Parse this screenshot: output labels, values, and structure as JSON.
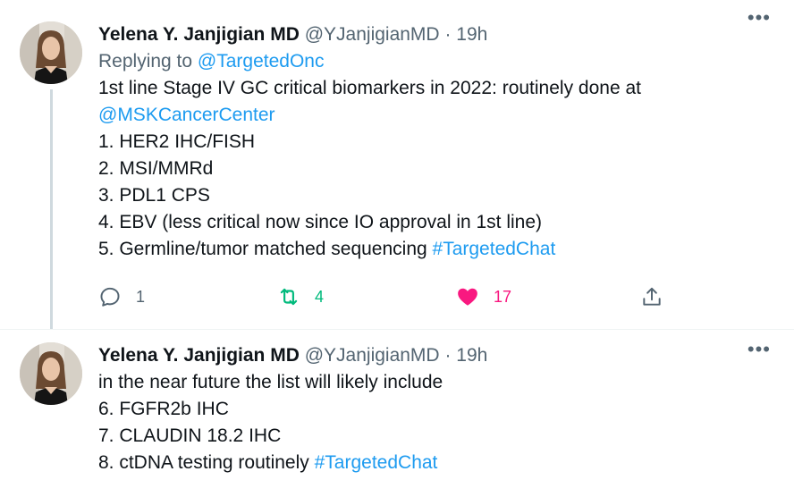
{
  "tweets": [
    {
      "author": {
        "name": "Yelena Y. Janjigian MD",
        "handle": "@YJanjigianMD"
      },
      "separator": "·",
      "time": "19h",
      "more_label": "•••",
      "reply_prefix": "Replying to ",
      "reply_handle": "@TargetedOnc",
      "lines": {
        "l1": "1st line Stage IV GC critical biomarkers in 2022: routinely done at",
        "l2_mention": "@MSKCancerCenter",
        "l3": "1. HER2 IHC/FISH",
        "l4": "2. MSI/MMRd",
        "l5": "3. PDL1 CPS",
        "l6": "4. EBV (less critical now since IO approval in 1st line)",
        "l7_text": "5. Germline/tumor matched sequencing ",
        "l7_hashtag": "#TargetedChat"
      },
      "actions": {
        "reply_count": "1",
        "retweet_count": "4",
        "like_count": "17",
        "liked": true,
        "retweeted": true
      },
      "icons": [
        "reply-icon",
        "retweet-icon",
        "heart-icon",
        "share-icon",
        "more-icon"
      ]
    },
    {
      "author": {
        "name": "Yelena Y. Janjigian MD",
        "handle": "@YJanjigianMD"
      },
      "separator": "·",
      "time": "19h",
      "more_label": "•••",
      "lines": {
        "l1": "in the near future the list will likely include",
        "l2": "6. FGFR2b IHC",
        "l3": "7. CLAUDIN 18.2 IHC",
        "l4_text": "8. ctDNA testing routinely ",
        "l4_hashtag": "#TargetedChat"
      }
    }
  ],
  "colors": {
    "link": "#1d9bf0",
    "secondary_text": "#536471",
    "retweet_active": "#00ba7c",
    "like_active": "#f91880",
    "thread_line": "#cfd9de"
  }
}
